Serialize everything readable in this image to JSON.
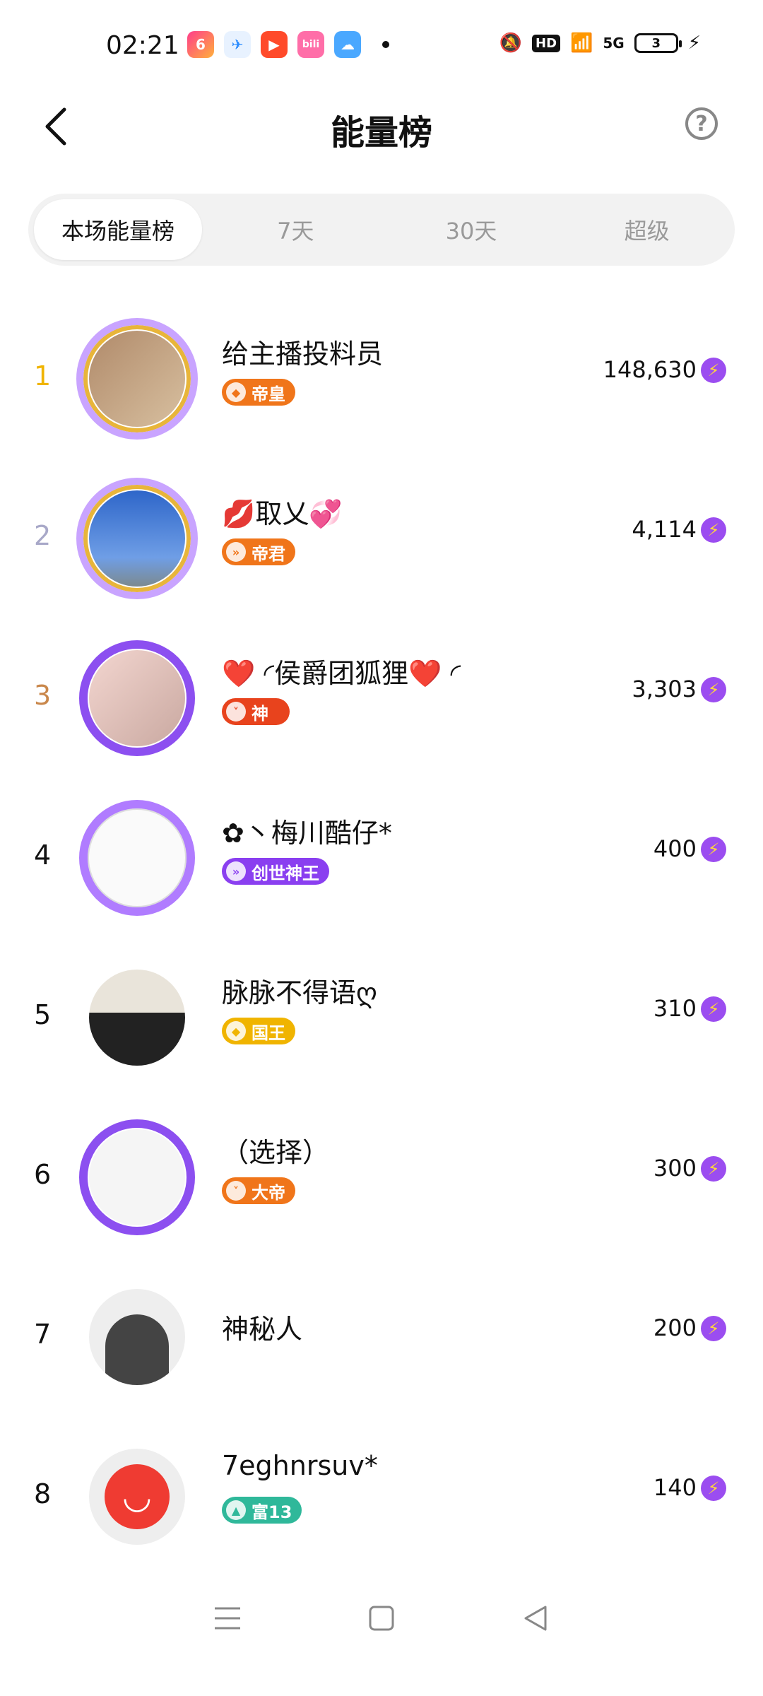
{
  "status": {
    "time": "02:21",
    "battery": "3",
    "network": "5G"
  },
  "header": {
    "title": "能量榜"
  },
  "tabs": [
    "本场能量榜",
    "7天",
    "30天",
    "超级"
  ],
  "leaderboard": [
    {
      "rank": "1",
      "name": "给主播投料员",
      "badge": "帝皇",
      "score": "148,630",
      "rank_color": "#f0b400",
      "badge_color": "#f0751a"
    },
    {
      "rank": "2",
      "name": "💋取乂💞",
      "badge": "帝君",
      "score": "4,114",
      "rank_color": "#a8a8c8",
      "badge_color": "#f0751a"
    },
    {
      "rank": "3",
      "name": "❤️ ◜侯爵团狐狸❤️ ◜",
      "badge": "神",
      "score": "3,303",
      "rank_color": "#c9874b",
      "badge_color": "#e8431d"
    },
    {
      "rank": "4",
      "name": "✿丶梅川酷仔*",
      "badge": "创世神王",
      "score": "400",
      "rank_color": "#111111",
      "badge_color": "#8a3ff0"
    },
    {
      "rank": "5",
      "name": "脉脉不得语ღ",
      "badge": "国王",
      "score": "310",
      "rank_color": "#111111",
      "badge_color": "#f0b400"
    },
    {
      "rank": "6",
      "name": "（选择）",
      "badge": "大帝",
      "score": "300",
      "rank_color": "#111111",
      "badge_color": "#f0751a"
    },
    {
      "rank": "7",
      "name": "神秘人",
      "badge": "",
      "score": "200",
      "rank_color": "#111111",
      "badge_color": ""
    },
    {
      "rank": "8",
      "name": "7eghnrsuv*",
      "badge": "富13",
      "score": "140",
      "rank_color": "#111111",
      "badge_color": "#2fb89a"
    }
  ],
  "icons": {
    "energy": "lightning-icon",
    "back": "chevron-left-icon",
    "help": "question-circle-icon"
  }
}
